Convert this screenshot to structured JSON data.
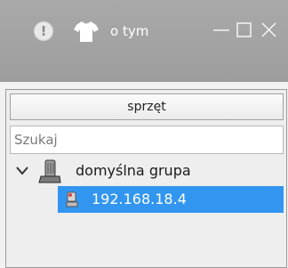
{
  "titlebar": {
    "about_label": "o tym",
    "icons": [
      "info-icon",
      "shirt-icon",
      "minimize-icon",
      "maximize-icon",
      "close-icon"
    ]
  },
  "panel": {
    "header": "sprzęt",
    "search": {
      "value": "",
      "placeholder": "Szukaj"
    },
    "tree": {
      "group": {
        "label": "domyślna grupa",
        "expanded": true,
        "icon": "device-group-icon"
      },
      "items": [
        {
          "label": "192.168.18.4",
          "selected": true,
          "icon": "device-icon"
        }
      ]
    }
  },
  "colors": {
    "titlebar": "#a2a2a2",
    "selection": "#3296f0",
    "text": "#1a1a1a"
  }
}
